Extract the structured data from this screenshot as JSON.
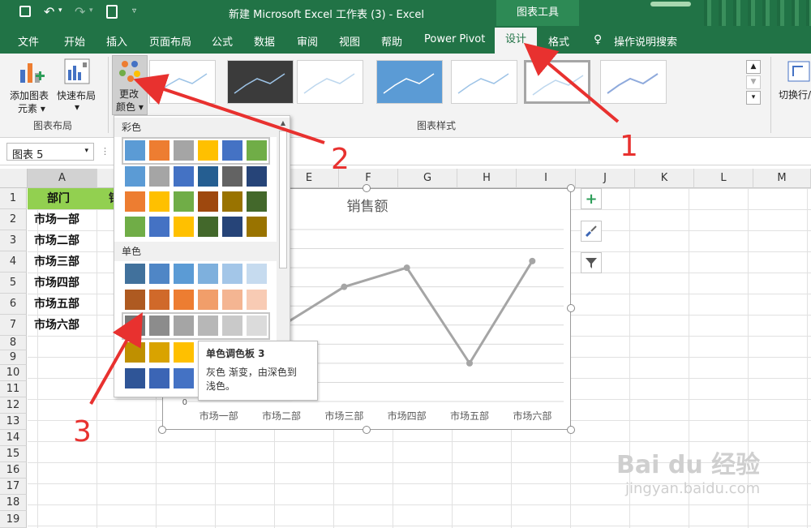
{
  "titlebar": {
    "title": "新建 Microsoft Excel 工作表 (3)  -  Excel",
    "context_tab": "图表工具"
  },
  "tabs": [
    "文件",
    "开始",
    "插入",
    "页面布局",
    "公式",
    "数据",
    "审阅",
    "视图",
    "帮助",
    "Power Pivot",
    "设计",
    "格式",
    "操作说明搜索"
  ],
  "active_tab": "设计",
  "ribbon": {
    "add_element": [
      "添加图表",
      "元素 ▾"
    ],
    "quick_layout": [
      "快速布局",
      "▾"
    ],
    "change_color": [
      "更改",
      "颜色 ▾"
    ],
    "group_layout": "图表布局",
    "group_styles": "图表样式",
    "switch_rowcol": "切换行/"
  },
  "namebox": "图表 5",
  "columns": [
    "A",
    "B",
    "C",
    "D",
    "E",
    "F",
    "G",
    "H",
    "I",
    "J",
    "K",
    "L",
    "M"
  ],
  "rows": [
    "1",
    "2",
    "3",
    "4",
    "5",
    "6",
    "7",
    "8",
    "9",
    "10",
    "11",
    "12",
    "13",
    "14",
    "15",
    "16",
    "17",
    "18",
    "19"
  ],
  "cells": {
    "header": "部门",
    "partial_b1": "销",
    "departments": [
      "市场一部",
      "市场二部",
      "市场三部",
      "市场四部",
      "市场五部",
      "市场六部"
    ]
  },
  "palette": {
    "section_color": "彩色",
    "section_mono": "单色",
    "color_rows": [
      [
        "#5b9bd5",
        "#ed7d31",
        "#a5a5a5",
        "#ffc000",
        "#4472c4",
        "#70ad47"
      ],
      [
        "#5b9bd5",
        "#a5a5a5",
        "#4472c4",
        "#255e91",
        "#636363",
        "#264478"
      ],
      [
        "#ed7d31",
        "#ffc000",
        "#70ad47",
        "#9e480e",
        "#997300",
        "#43682b"
      ],
      [
        "#70ad47",
        "#4472c4",
        "#ffc000",
        "#43682b",
        "#264478",
        "#997300"
      ]
    ],
    "mono_rows": [
      [
        "#41719c",
        "#4f86c6",
        "#5b9bd5",
        "#7eb0dd",
        "#a3c6e8",
        "#c6dbef"
      ],
      [
        "#ae5a21",
        "#d0692a",
        "#ed7d31",
        "#f19e6a",
        "#f4b592",
        "#f8cbb4"
      ],
      [
        "#767676",
        "#8c8c8c",
        "#a5a5a5",
        "#b7b7b7",
        "#c9c9c9",
        "#dbdbdb"
      ],
      [
        "#bf9000",
        "#d9a300",
        "#ffc000"
      ],
      [
        "#2f5597",
        "#3b65b5",
        "#4472c4"
      ]
    ]
  },
  "tooltip": {
    "title": "单色调色板 3",
    "desc_line1": "灰色 渐变，由深色到",
    "desc_line2": "浅色。"
  },
  "chart_data": {
    "type": "line",
    "title": "销售额",
    "categories": [
      "市场一部",
      "市场二部",
      "市场三部",
      "市场四部",
      "市场五部",
      "市场六部"
    ],
    "values": [
      68,
      79,
      120,
      140,
      40,
      147
    ],
    "ylim": [
      0,
      180
    ],
    "y_tick_visible": "0",
    "line_color": "#a5a5a5",
    "grid": true
  },
  "annotations": {
    "arrow1": "1",
    "arrow2": "2",
    "arrow3": "3",
    "arrow_color": "#e8312f"
  },
  "watermark": {
    "text": "Bai du 经验",
    "url": "jingyan.baidu.com"
  }
}
